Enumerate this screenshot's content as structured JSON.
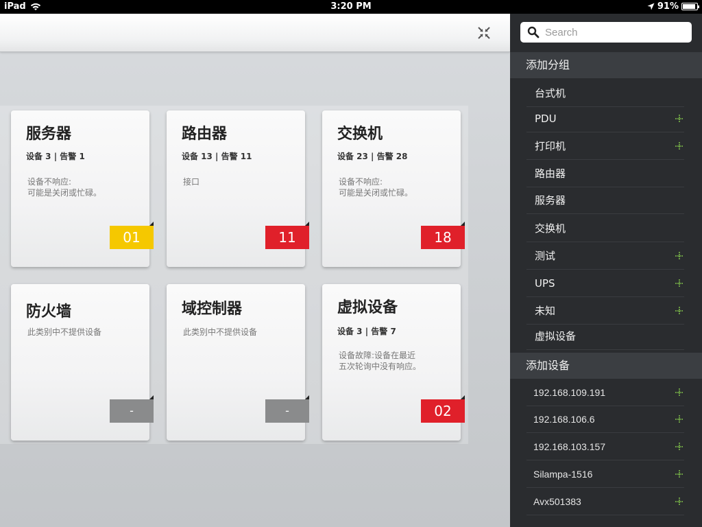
{
  "status_bar": {
    "device": "iPad",
    "time": "3:20 PM",
    "battery": "91%",
    "battery_level": 0.91
  },
  "colors": {
    "badge_yellow": "#f5c800",
    "badge_red": "#e0202a",
    "badge_grey": "#8a8b8c",
    "plus_icon": "#7fc24a",
    "sidebar_bg": "#2a2c2f"
  },
  "cards": [
    {
      "title": "服务器",
      "stats": "设备 3 | 告警 1",
      "desc_line1": "设备不响应:",
      "desc_line2": "可能是关闭或忙碌。",
      "badge": "01",
      "badge_color": "yellow"
    },
    {
      "title": "路由器",
      "stats": "设备 13 | 告警 11",
      "desc_line1": "接口",
      "desc_line2": "",
      "badge": "11",
      "badge_color": "red"
    },
    {
      "title": "交换机",
      "stats": "设备 23 | 告警 28",
      "desc_line1": "设备不响应:",
      "desc_line2": "可能是关闭或忙碌。",
      "badge": "18",
      "badge_color": "red"
    },
    {
      "title": "防火墙",
      "stats": "",
      "desc_line1": "此类别中不提供设备",
      "desc_line2": "",
      "badge": "-",
      "badge_color": "grey"
    },
    {
      "title": "域控制器",
      "stats": "",
      "desc_line1": "此类别中不提供设备",
      "desc_line2": "",
      "badge": "-",
      "badge_color": "grey"
    },
    {
      "title": "虚拟设备",
      "stats": "设备 3 | 告警 7",
      "desc_line1": "设备故障:设备在最近",
      "desc_line2": "五次轮询中没有响应。",
      "badge": "02",
      "badge_color": "red"
    }
  ],
  "sidebar": {
    "search_placeholder": "Search",
    "group_header": "添加分组",
    "groups": [
      {
        "label": "台式机",
        "has_add": false
      },
      {
        "label": "PDU",
        "has_add": true
      },
      {
        "label": "打印机",
        "has_add": true
      },
      {
        "label": "路由器",
        "has_add": false
      },
      {
        "label": "服务器",
        "has_add": false
      },
      {
        "label": "交换机",
        "has_add": false
      },
      {
        "label": "测试",
        "has_add": true
      },
      {
        "label": "UPS",
        "has_add": true
      },
      {
        "label": "未知",
        "has_add": true
      },
      {
        "label": "虚拟设备",
        "has_add": false
      }
    ],
    "device_header": "添加设备",
    "devices": [
      {
        "label": "192.168.109.191"
      },
      {
        "label": "192.168.106.6"
      },
      {
        "label": "192.168.103.157"
      },
      {
        "label": "Silampa-1516"
      },
      {
        "label": "Avx501383"
      }
    ]
  }
}
